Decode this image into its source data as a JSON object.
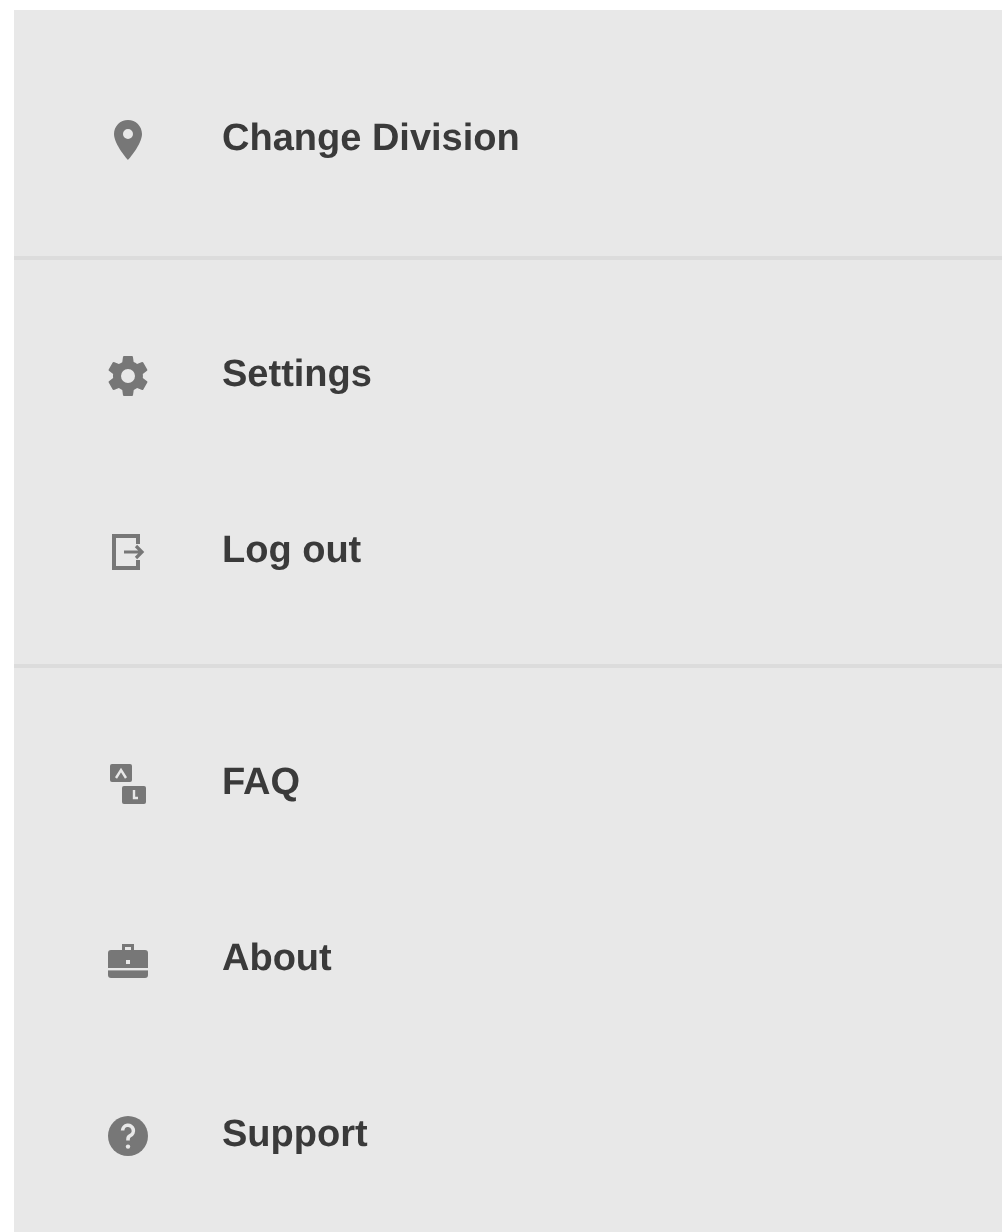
{
  "menu": {
    "sections": [
      {
        "items": [
          {
            "kind": "pin",
            "label": "Change Division"
          }
        ]
      },
      {
        "items": [
          {
            "kind": "gear",
            "label": "Settings"
          },
          {
            "kind": "exit",
            "label": "Log out"
          }
        ]
      },
      {
        "items": [
          {
            "kind": "faq",
            "label": "FAQ"
          },
          {
            "kind": "briefcase",
            "label": "About"
          },
          {
            "kind": "help",
            "label": "Support"
          }
        ]
      }
    ]
  }
}
